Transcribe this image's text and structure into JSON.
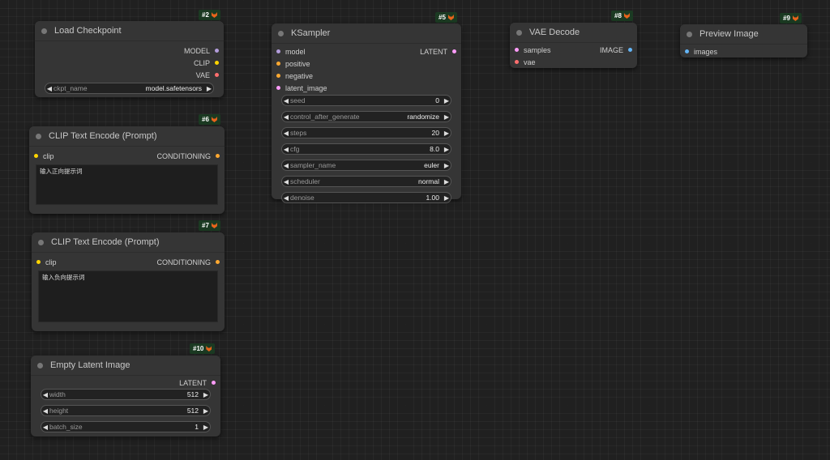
{
  "colors": {
    "model": "#b39ddb",
    "clip": "#ffd500",
    "vae": "#ff6e6e",
    "conditioning": "#ffa931",
    "latent": "#ff9cf9",
    "image": "#64b5f6",
    "badge_bg": "#1b3a22"
  },
  "nodes": {
    "load_checkpoint": {
      "id": "#2",
      "title": "Load Checkpoint",
      "outputs": [
        "MODEL",
        "CLIP",
        "VAE"
      ],
      "widget": {
        "label": "ckpt_name",
        "value": "model.safetensors"
      }
    },
    "clip_pos": {
      "id": "#6",
      "title": "CLIP Text Encode (Prompt)",
      "input": "clip",
      "output": "CONDITIONING",
      "text": "输入正向提示词"
    },
    "clip_neg": {
      "id": "#7",
      "title": "CLIP Text Encode (Prompt)",
      "input": "clip",
      "output": "CONDITIONING",
      "text": "输入负向提示词"
    },
    "empty_latent": {
      "id": "#10",
      "title": "Empty Latent Image",
      "output": "LATENT",
      "widgets": [
        {
          "label": "width",
          "value": "512"
        },
        {
          "label": "height",
          "value": "512"
        },
        {
          "label": "batch_size",
          "value": "1"
        }
      ]
    },
    "ksampler": {
      "id": "#5",
      "title": "KSampler",
      "inputs": [
        "model",
        "positive",
        "negative",
        "latent_image"
      ],
      "output": "LATENT",
      "widgets": [
        {
          "label": "seed",
          "value": "0"
        },
        {
          "label": "control_after_generate",
          "value": "randomize"
        },
        {
          "label": "steps",
          "value": "20"
        },
        {
          "label": "cfg",
          "value": "8.0"
        },
        {
          "label": "sampler_name",
          "value": "euler"
        },
        {
          "label": "scheduler",
          "value": "normal"
        },
        {
          "label": "denoise",
          "value": "1.00"
        }
      ]
    },
    "vae_decode": {
      "id": "#8",
      "title": "VAE Decode",
      "inputs": [
        "samples",
        "vae"
      ],
      "output": "IMAGE"
    },
    "preview_image": {
      "id": "#9",
      "title": "Preview Image",
      "inputs": [
        "images"
      ]
    }
  },
  "icons": {
    "badge": "fox-icon",
    "left": "arrow-left-icon",
    "right": "arrow-right-icon"
  }
}
